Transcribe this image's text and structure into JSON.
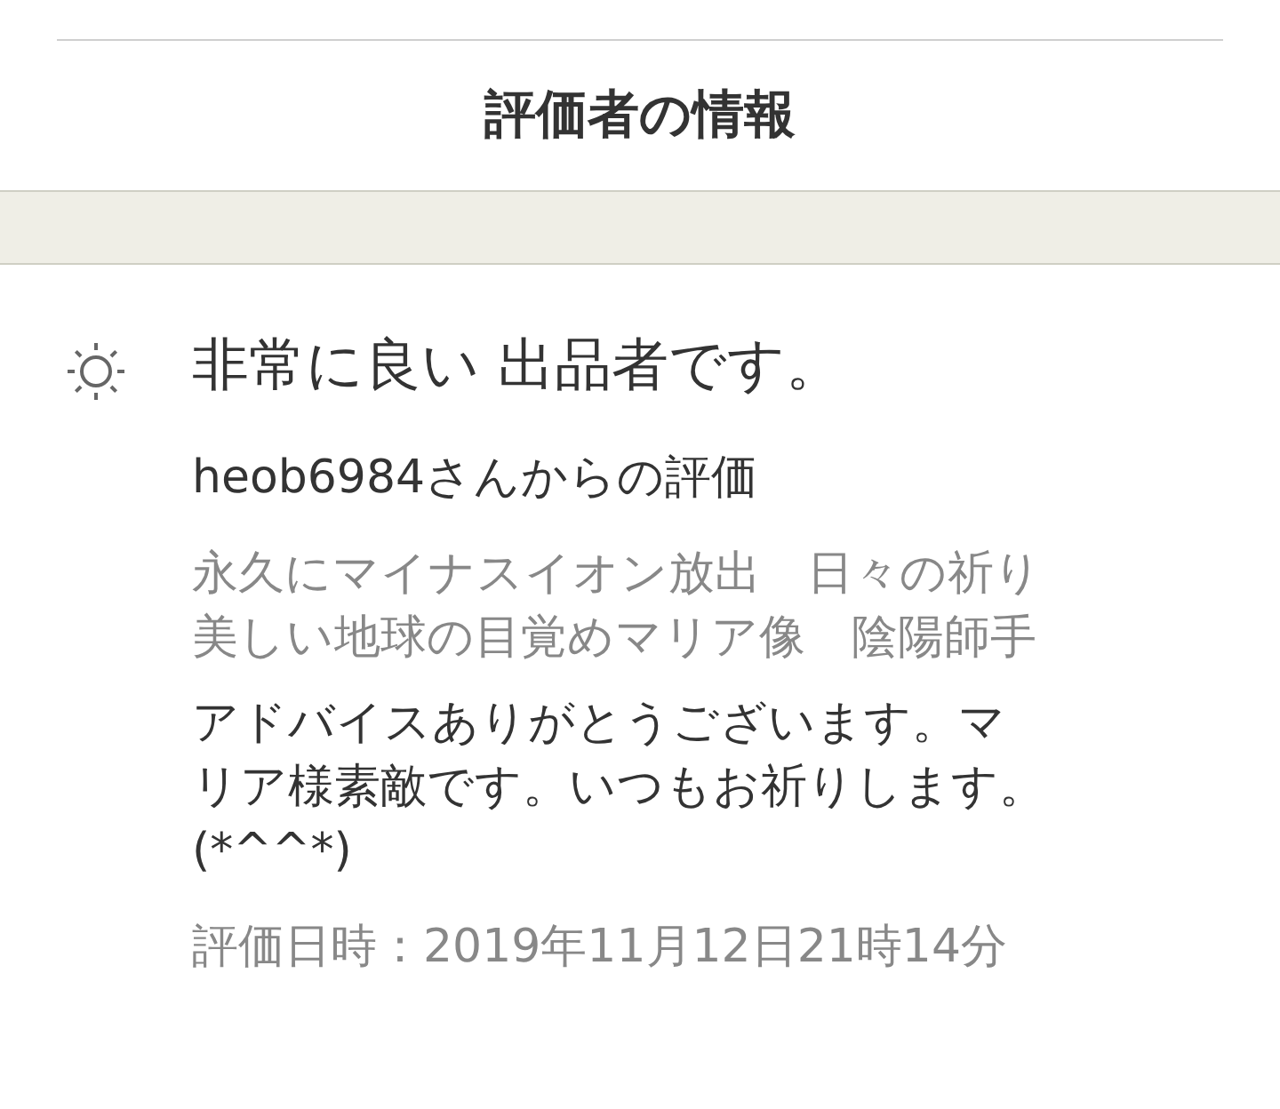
{
  "header": {
    "title": "評価者の情報"
  },
  "review": {
    "headline": "非常に良い 出品者です。",
    "reviewer": "heob6984さんからの評価",
    "item_title_lines": [
      "永久にマイナスイオン放出　日々の祈り",
      "美しい地球の目覚めマリア像　陰陽師手"
    ],
    "comment_lines": [
      "アドバイスありがとうございます。マ",
      "リア様素敵です。いつもお祈りします。",
      "(*^^*)"
    ],
    "date": "評価日時：2019年11月12日21時14分"
  }
}
